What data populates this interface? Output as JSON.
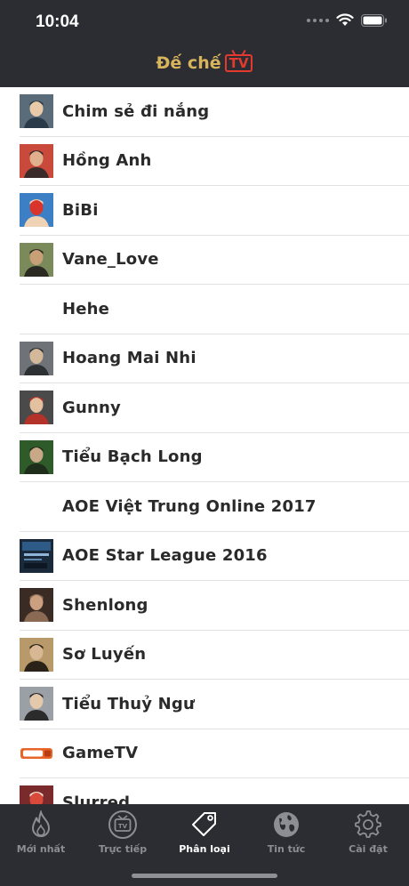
{
  "status_bar": {
    "time": "10:04"
  },
  "header": {
    "logo_text": "Đế chế",
    "logo_badge": "TV"
  },
  "channels": [
    {
      "name": "Chim sẻ đi nắng",
      "avatar": "photo-avatar"
    },
    {
      "name": "Hồng Anh",
      "avatar": "photo-avatar"
    },
    {
      "name": "BiBi",
      "avatar": "photo-avatar"
    },
    {
      "name": "Vane_Love",
      "avatar": "photo-avatar"
    },
    {
      "name": "Hehe",
      "avatar": "none"
    },
    {
      "name": "Hoang Mai Nhi",
      "avatar": "photo-avatar"
    },
    {
      "name": "Gunny",
      "avatar": "photo-avatar"
    },
    {
      "name": "Tiểu Bạch Long",
      "avatar": "photo-avatar"
    },
    {
      "name": "AOE Việt Trung Online 2017",
      "avatar": "none"
    },
    {
      "name": "AOE Star League 2016",
      "avatar": "league-logo"
    },
    {
      "name": "Shenlong",
      "avatar": "photo-avatar"
    },
    {
      "name": "Sơ Luyến",
      "avatar": "photo-avatar"
    },
    {
      "name": "Tiểu Thuỷ Ngư",
      "avatar": "photo-avatar"
    },
    {
      "name": "GameTV",
      "avatar": "gametv-logo"
    },
    {
      "name": "Slurred",
      "avatar": "photo-avatar"
    }
  ],
  "tabs": [
    {
      "label": "Mới nhất",
      "icon": "flame-icon",
      "active": false
    },
    {
      "label": "Trực tiếp",
      "icon": "tv-icon",
      "active": false
    },
    {
      "label": "Phân loại",
      "icon": "tag-icon",
      "active": true
    },
    {
      "label": "Tin tức",
      "icon": "globe-icon",
      "active": false
    },
    {
      "label": "Cài đặt",
      "icon": "gear-icon",
      "active": false
    }
  ],
  "colors": {
    "bar_background": "#2b2d33",
    "logo_gold": "#d8b45c",
    "logo_red": "#e23a2e",
    "tab_inactive": "#8c8e94",
    "tab_active": "#ffffff"
  }
}
